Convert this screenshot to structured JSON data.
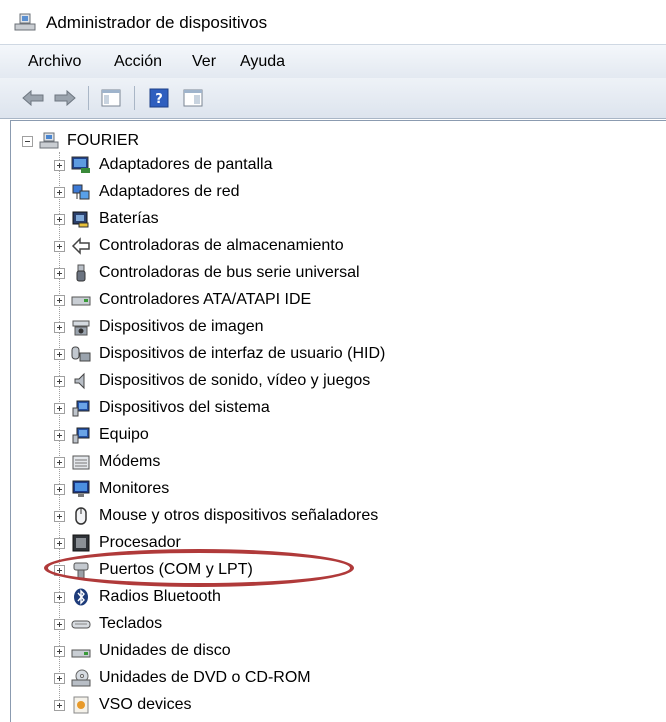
{
  "window": {
    "title": "Administrador de dispositivos",
    "title_icon": "device-manager-icon"
  },
  "menu": [
    "Archivo",
    "Acción",
    "Ver",
    "Ayuda"
  ],
  "toolbar": {
    "buttons": [
      "back-arrow-icon",
      "forward-arrow-icon",
      "show-hide-tree-icon",
      "help-icon",
      "properties-icon"
    ]
  },
  "tree": {
    "root": {
      "label": "FOURIER",
      "icon": "computer-icon",
      "expanded": true
    },
    "items": [
      {
        "label": "Adaptadores de pantalla",
        "icon": "display-adapter-icon"
      },
      {
        "label": "Adaptadores de red",
        "icon": "network-adapter-icon"
      },
      {
        "label": "Baterías",
        "icon": "battery-icon"
      },
      {
        "label": "Controladoras de almacenamiento",
        "icon": "storage-controller-icon"
      },
      {
        "label": "Controladoras de bus serie universal",
        "icon": "usb-icon"
      },
      {
        "label": "Controladores ATA/ATAPI IDE",
        "icon": "ide-controller-icon"
      },
      {
        "label": "Dispositivos de imagen",
        "icon": "imaging-device-icon"
      },
      {
        "label": "Dispositivos de interfaz de usuario (HID)",
        "icon": "hid-icon"
      },
      {
        "label": "Dispositivos de sonido, vídeo y juegos",
        "icon": "speaker-icon"
      },
      {
        "label": "Dispositivos del sistema",
        "icon": "system-device-icon"
      },
      {
        "label": "Equipo",
        "icon": "computer-monitor-icon"
      },
      {
        "label": "Módems",
        "icon": "modem-icon"
      },
      {
        "label": "Monitores",
        "icon": "monitor-icon"
      },
      {
        "label": "Mouse y otros dispositivos señaladores",
        "icon": "mouse-icon"
      },
      {
        "label": "Procesador",
        "icon": "processor-icon"
      },
      {
        "label": "Puertos (COM y LPT)",
        "icon": "port-icon"
      },
      {
        "label": "Radios Bluetooth",
        "icon": "bluetooth-icon"
      },
      {
        "label": "Teclados",
        "icon": "keyboard-icon"
      },
      {
        "label": "Unidades de disco",
        "icon": "disk-drive-icon"
      },
      {
        "label": "Unidades de DVD o CD-ROM",
        "icon": "dvd-drive-icon"
      },
      {
        "label": "VSO devices",
        "icon": "vso-device-icon"
      }
    ]
  },
  "colors": {
    "highlight_ellipse": "#b03a3a"
  }
}
